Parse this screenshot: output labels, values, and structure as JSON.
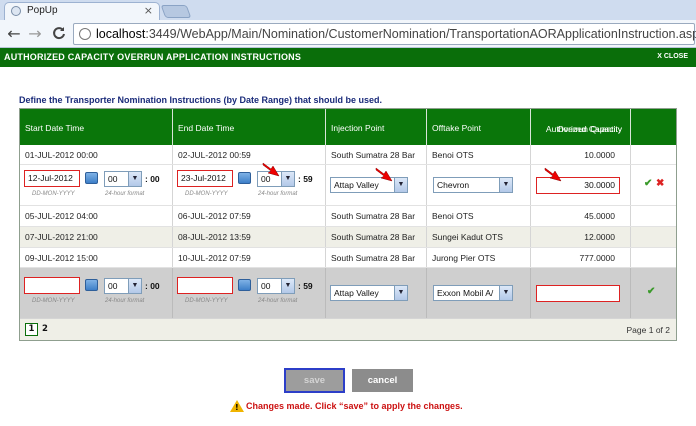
{
  "browser": {
    "tab_title": "PopUp",
    "tab_close": "×",
    "url_host": "localhost",
    "url_rest": ":3449/WebApp/Main/Nomination/CustomerNomination/TransportationAORApplicationInstruction.aspx",
    "back": "←",
    "forward": "→",
    "reload": "C"
  },
  "header": {
    "title": "AUTHORIZED CAPACITY OVERRUN APPLICATION INSTRUCTIONS",
    "close": "X CLOSE"
  },
  "instructions": "Define the Transporter Nomination Instructions (by Date Range) that should be used.",
  "columns": {
    "start": "Start Date Time",
    "end": "End Date Time",
    "injection": "Injection Point",
    "offtake": "Offtake Point",
    "auth_line1": "Authorized Capacity",
    "auth_line2": "Overrun Quantity"
  },
  "rows": [
    {
      "start": "01-JUL-2012 00:00",
      "end": "02-JUL-2012 00:59",
      "injection": "South Sumatra 28 Bar",
      "offtake": "Benoi OTS",
      "qty": "10.0000"
    },
    {
      "start": "05-JUL-2012 04:00",
      "end": "06-JUL-2012 07:59",
      "injection": "South Sumatra 28 Bar",
      "offtake": "Benoi OTS",
      "qty": "45.0000"
    },
    {
      "start": "07-JUL-2012 21:00",
      "end": "08-JUL-2012 13:59",
      "injection": "South Sumatra 28 Bar",
      "offtake": "Sungei Kadut OTS",
      "qty": "12.0000"
    },
    {
      "start": "09-JUL-2012 15:00",
      "end": "10-JUL-2012 07:59",
      "injection": "South Sumatra 28 Bar",
      "offtake": "Jurong Pier OTS",
      "qty": "777.0000"
    }
  ],
  "edit_row": {
    "start_date": "12-Jul-2012",
    "start_hour": "00",
    "start_min": ": 00",
    "end_date": "23-Jul-2012",
    "end_hour": "00",
    "end_min": ": 59",
    "date_hint": "DD-MON-YYYY",
    "hour_hint": "24-hour format",
    "injection": "Attap Valley",
    "offtake": "Chevron",
    "qty": "30.0000"
  },
  "new_row": {
    "start_date": "",
    "start_hour": "00",
    "start_min": ": 00",
    "end_date": "",
    "end_hour": "00",
    "end_min": ": 59",
    "date_hint": "DD-MON-YYYY",
    "hour_hint": "24-hour format",
    "injection": "Attap Valley",
    "offtake": "Exxon Mobil A/",
    "qty": ""
  },
  "pager": {
    "page1": "1",
    "page2": "2",
    "info": "Page 1 of 2"
  },
  "buttons": {
    "save": "save",
    "cancel": "cancel"
  },
  "warning": "Changes made. Click “save” to apply the changes.",
  "colors": {
    "header_green": "#0a6e0a",
    "error_red": "#cc1111"
  }
}
